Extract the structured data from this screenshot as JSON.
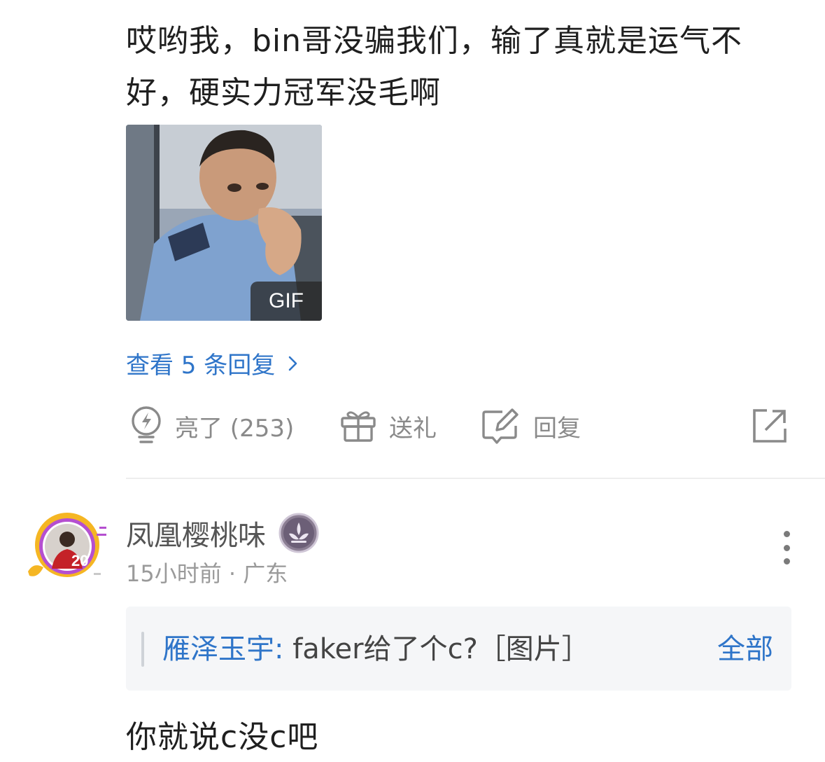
{
  "comment1": {
    "body": "哎哟我，bin哥没骗我们，输了真就是运气不好，硬实力冠军没毛啊",
    "gif_badge": "GIF",
    "view_replies": "查看 5 条回复",
    "actions": {
      "like_label": "亮了 (253)",
      "gift_label": "送礼",
      "reply_label": "回复"
    }
  },
  "comment2": {
    "username": "凤凰樱桃味",
    "time": "15小时前",
    "separator": " · ",
    "location": "广东",
    "quote": {
      "author": "雁泽玉宇:",
      "text": " faker给了个c?［图片］",
      "expand_label": "全部"
    },
    "body": "你就说c没c吧"
  },
  "colors": {
    "link_blue": "#2f75c9",
    "muted_gray": "#8a8a8a",
    "text_dark": "#1f1f1f",
    "quote_bg": "#f5f6f8"
  },
  "icons": {
    "like": "lightbulb-icon",
    "gift": "gift-icon",
    "reply": "edit-reply-icon",
    "share": "share-icon",
    "more": "more-vertical-icon",
    "chevron": "chevron-right-icon"
  }
}
